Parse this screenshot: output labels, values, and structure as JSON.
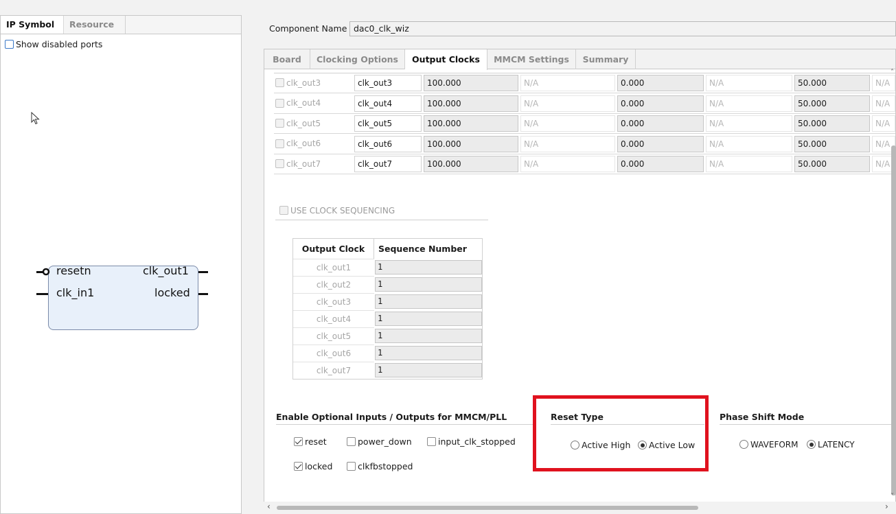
{
  "left_panel": {
    "tabs": [
      "IP Symbol",
      "Resource"
    ],
    "show_disabled_ports": "Show disabled ports",
    "ip_symbol": {
      "left_ports": [
        "resetn",
        "clk_in1"
      ],
      "right_ports": [
        "clk_out1",
        "locked"
      ]
    }
  },
  "component": {
    "label": "Component Name",
    "value": "dac0_clk_wiz"
  },
  "tabs": [
    "Board",
    "Clocking Options",
    "Output Clocks",
    "MMCM Settings",
    "Summary"
  ],
  "active_tab": "Output Clocks",
  "output_clocks": {
    "rows": [
      {
        "enable": "clk_out3",
        "port_name": "clk_out3",
        "freq": "100.000",
        "actual_freq": "N/A",
        "phase": "0.000",
        "actual_phase": "N/A",
        "duty": "50.000",
        "actual_duty": "N/A"
      },
      {
        "enable": "clk_out4",
        "port_name": "clk_out4",
        "freq": "100.000",
        "actual_freq": "N/A",
        "phase": "0.000",
        "actual_phase": "N/A",
        "duty": "50.000",
        "actual_duty": "N/A"
      },
      {
        "enable": "clk_out5",
        "port_name": "clk_out5",
        "freq": "100.000",
        "actual_freq": "N/A",
        "phase": "0.000",
        "actual_phase": "N/A",
        "duty": "50.000",
        "actual_duty": "N/A"
      },
      {
        "enable": "clk_out6",
        "port_name": "clk_out6",
        "freq": "100.000",
        "actual_freq": "N/A",
        "phase": "0.000",
        "actual_phase": "N/A",
        "duty": "50.000",
        "actual_duty": "N/A"
      },
      {
        "enable": "clk_out7",
        "port_name": "clk_out7",
        "freq": "100.000",
        "actual_freq": "N/A",
        "phase": "0.000",
        "actual_phase": "N/A",
        "duty": "50.000",
        "actual_duty": "N/A"
      }
    ]
  },
  "clock_sequencing": {
    "label": "USE CLOCK SEQUENCING",
    "headers": [
      "Output Clock",
      "Sequence Number"
    ],
    "rows": [
      {
        "clock": "clk_out1",
        "seq": "1"
      },
      {
        "clock": "clk_out2",
        "seq": "1"
      },
      {
        "clock": "clk_out3",
        "seq": "1"
      },
      {
        "clock": "clk_out4",
        "seq": "1"
      },
      {
        "clock": "clk_out5",
        "seq": "1"
      },
      {
        "clock": "clk_out6",
        "seq": "1"
      },
      {
        "clock": "clk_out7",
        "seq": "1"
      }
    ]
  },
  "optional_io": {
    "title": "Enable Optional Inputs / Outputs for MMCM/PLL",
    "reset": "reset",
    "power_down": "power_down",
    "input_clk_stopped": "input_clk_stopped",
    "locked": "locked",
    "clkfbstopped": "clkfbstopped"
  },
  "reset_type": {
    "title": "Reset Type",
    "active_high": "Active High",
    "active_low": "Active Low",
    "selected": "Active Low"
  },
  "phase_shift_mode": {
    "title": "Phase Shift Mode",
    "waveform": "WAVEFORM",
    "latency": "LATENCY",
    "selected": "LATENCY"
  },
  "colors": {
    "highlight": "#e0121e",
    "block_fill": "#e8f0fa",
    "checkbox_accent": "#3a79c8"
  }
}
